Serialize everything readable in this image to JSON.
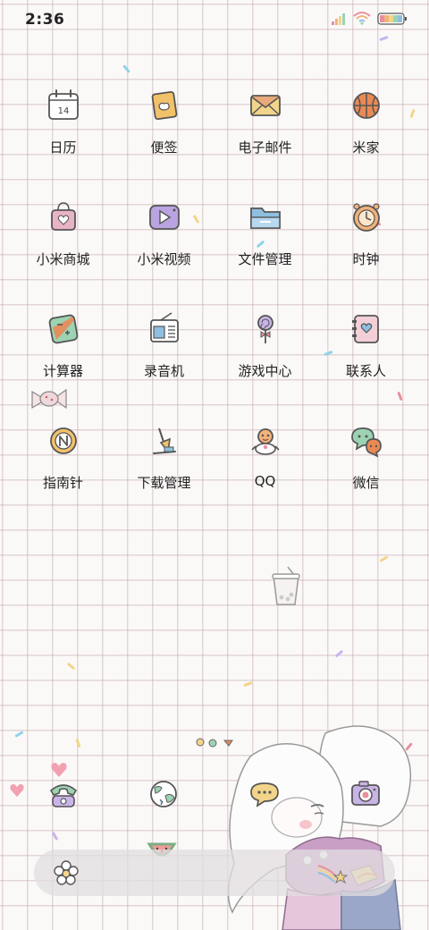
{
  "status_bar": {
    "time": "2:36",
    "icons": [
      "signal-icon",
      "wifi-icon",
      "battery-icon"
    ]
  },
  "apps": [
    {
      "label": "日历",
      "icon": "calendar-icon",
      "icon_text": "14"
    },
    {
      "label": "便签",
      "icon": "notes-icon"
    },
    {
      "label": "电子邮件",
      "icon": "email-icon"
    },
    {
      "label": "米家",
      "icon": "basketball-icon"
    },
    {
      "label": "小米商城",
      "icon": "shopping-bag-icon"
    },
    {
      "label": "小米视频",
      "icon": "video-icon"
    },
    {
      "label": "文件管理",
      "icon": "folder-icon"
    },
    {
      "label": "时钟",
      "icon": "clock-icon"
    },
    {
      "label": "计算器",
      "icon": "calculator-icon"
    },
    {
      "label": "录音机",
      "icon": "radio-icon"
    },
    {
      "label": "游戏中心",
      "icon": "lollipop-icon"
    },
    {
      "label": "联系人",
      "icon": "contacts-book-icon"
    },
    {
      "label": "指南针",
      "icon": "compass-icon"
    },
    {
      "label": "下载管理",
      "icon": "download-icon"
    },
    {
      "label": "QQ",
      "icon": "penguin-icon"
    },
    {
      "label": "微信",
      "icon": "chat-bubbles-icon"
    }
  ],
  "dock": {
    "apps": [
      {
        "icon": "phone-icon"
      },
      {
        "icon": "globe-icon"
      },
      {
        "icon": "message-icon"
      },
      {
        "icon": "camera-icon"
      }
    ],
    "page_indicator_icon": "flower-icon"
  },
  "colors": {
    "background": "#fbf9f8",
    "grid_line": "#c4aaac",
    "icon_stroke": "#555555",
    "pink": "#e88f9e",
    "yellow": "#f2d58a",
    "blue": "#8fbfe0",
    "purple": "#b9a3e0",
    "orange": "#e98a55",
    "green": "#9cd3b3"
  }
}
